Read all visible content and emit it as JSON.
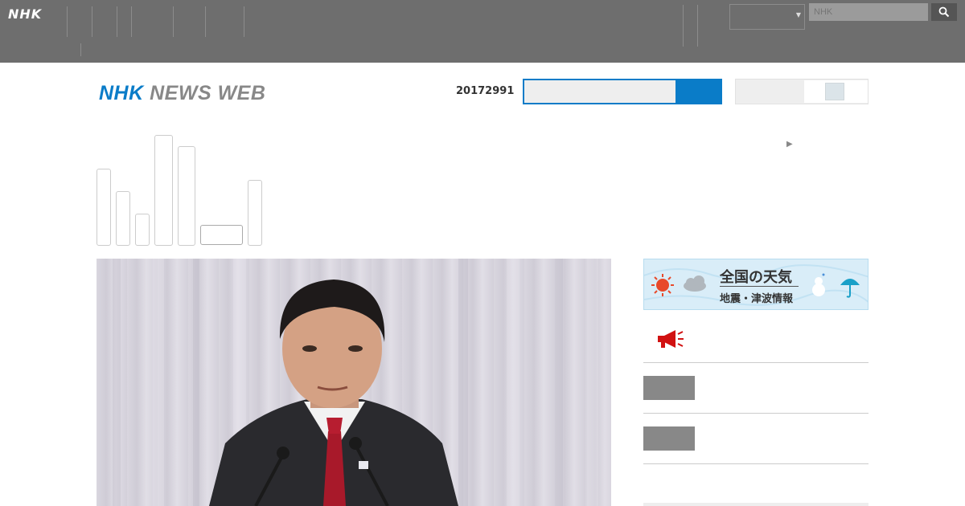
{
  "global_header": {
    "logo": "NHK",
    "nav_items": [
      {
        "lines": [
          "",
          "",
          ""
        ],
        "w": 0
      },
      {
        "lines": [
          "",
          ""
        ]
      },
      {
        "lines": [
          ""
        ]
      },
      {
        "lines": [
          "",
          ""
        ]
      },
      {
        "lines": [
          "",
          ""
        ]
      },
      {
        "lines": [
          "",
          "",
          ""
        ]
      }
    ],
    "region_value": "",
    "search_placeholder": "NHK"
  },
  "news_header": {
    "logo_nhk": "NHK",
    "logo_rest": "NEWS WEB",
    "date": "20172991",
    "search_placeholder": "",
    "toggle_label": ""
  },
  "tabs": {
    "active_label": "",
    "more_link": ""
  },
  "side": {
    "weather_title": "全国の天気",
    "weather_sub": "地震・津波情報",
    "links": [
      {
        "label": "",
        "icon": "megaphone-icon"
      },
      {
        "label": ""
      },
      {
        "label": ""
      }
    ]
  },
  "colors": {
    "brand_blue": "#0a7cc8",
    "header_gray": "#6e6e6e",
    "link_blue": "#0a5c8c",
    "alert_red": "#d11111"
  }
}
